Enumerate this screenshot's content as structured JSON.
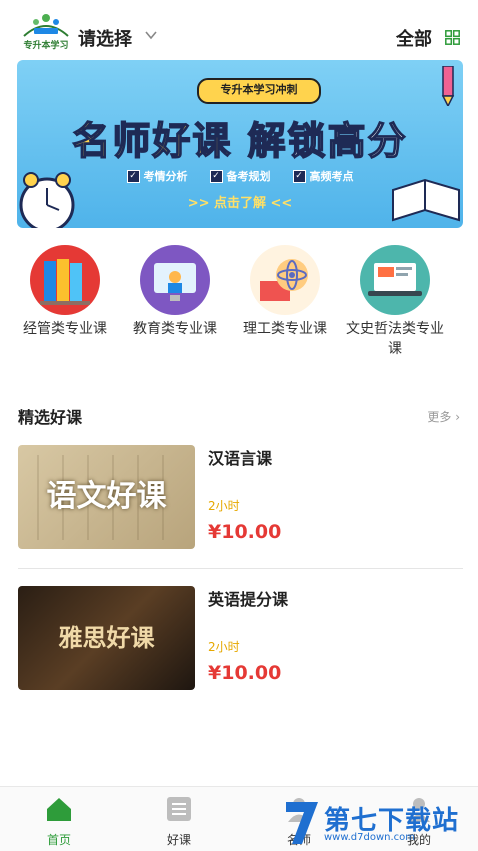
{
  "header": {
    "logo_text": "专升本学习",
    "city_label": "请选择",
    "all_label": "全部"
  },
  "banner": {
    "tag": "专升本学习冲刺",
    "title_part1": "名师好课",
    "title_part2": "解锁高分",
    "checks": [
      "考情分析",
      "备考规划",
      "高频考点"
    ],
    "cta": ">> 点击了解 <<"
  },
  "categories": [
    {
      "label": "经管类专业课",
      "icon": "books-icon"
    },
    {
      "label": "教育类专业课",
      "icon": "teacher-icon"
    },
    {
      "label": "理工类专业课",
      "icon": "atom-icon"
    },
    {
      "label": "文史哲法类专业课",
      "icon": "laptop-icon"
    }
  ],
  "section": {
    "title": "精选好课",
    "more": "更多"
  },
  "courses": [
    {
      "thumb_title": "语文好课",
      "name": "汉语言课",
      "duration": "2小时",
      "price": "¥10.00"
    },
    {
      "thumb_title": "雅思好课",
      "name": "英语提分课",
      "duration": "2小时",
      "price": "¥10.00"
    }
  ],
  "tabbar": {
    "tabs": [
      {
        "label": "首页",
        "active": true
      },
      {
        "label": "好课",
        "active": false
      },
      {
        "label": "名师",
        "active": false
      },
      {
        "label": "我的",
        "active": false
      }
    ]
  },
  "watermark": {
    "text": "第七下载站",
    "url": "www.d7down.com"
  },
  "colors": {
    "accent": "#2e9c3a",
    "price": "#e53935",
    "duration": "#e6a800",
    "banner_bg": "#4fb3ea"
  }
}
